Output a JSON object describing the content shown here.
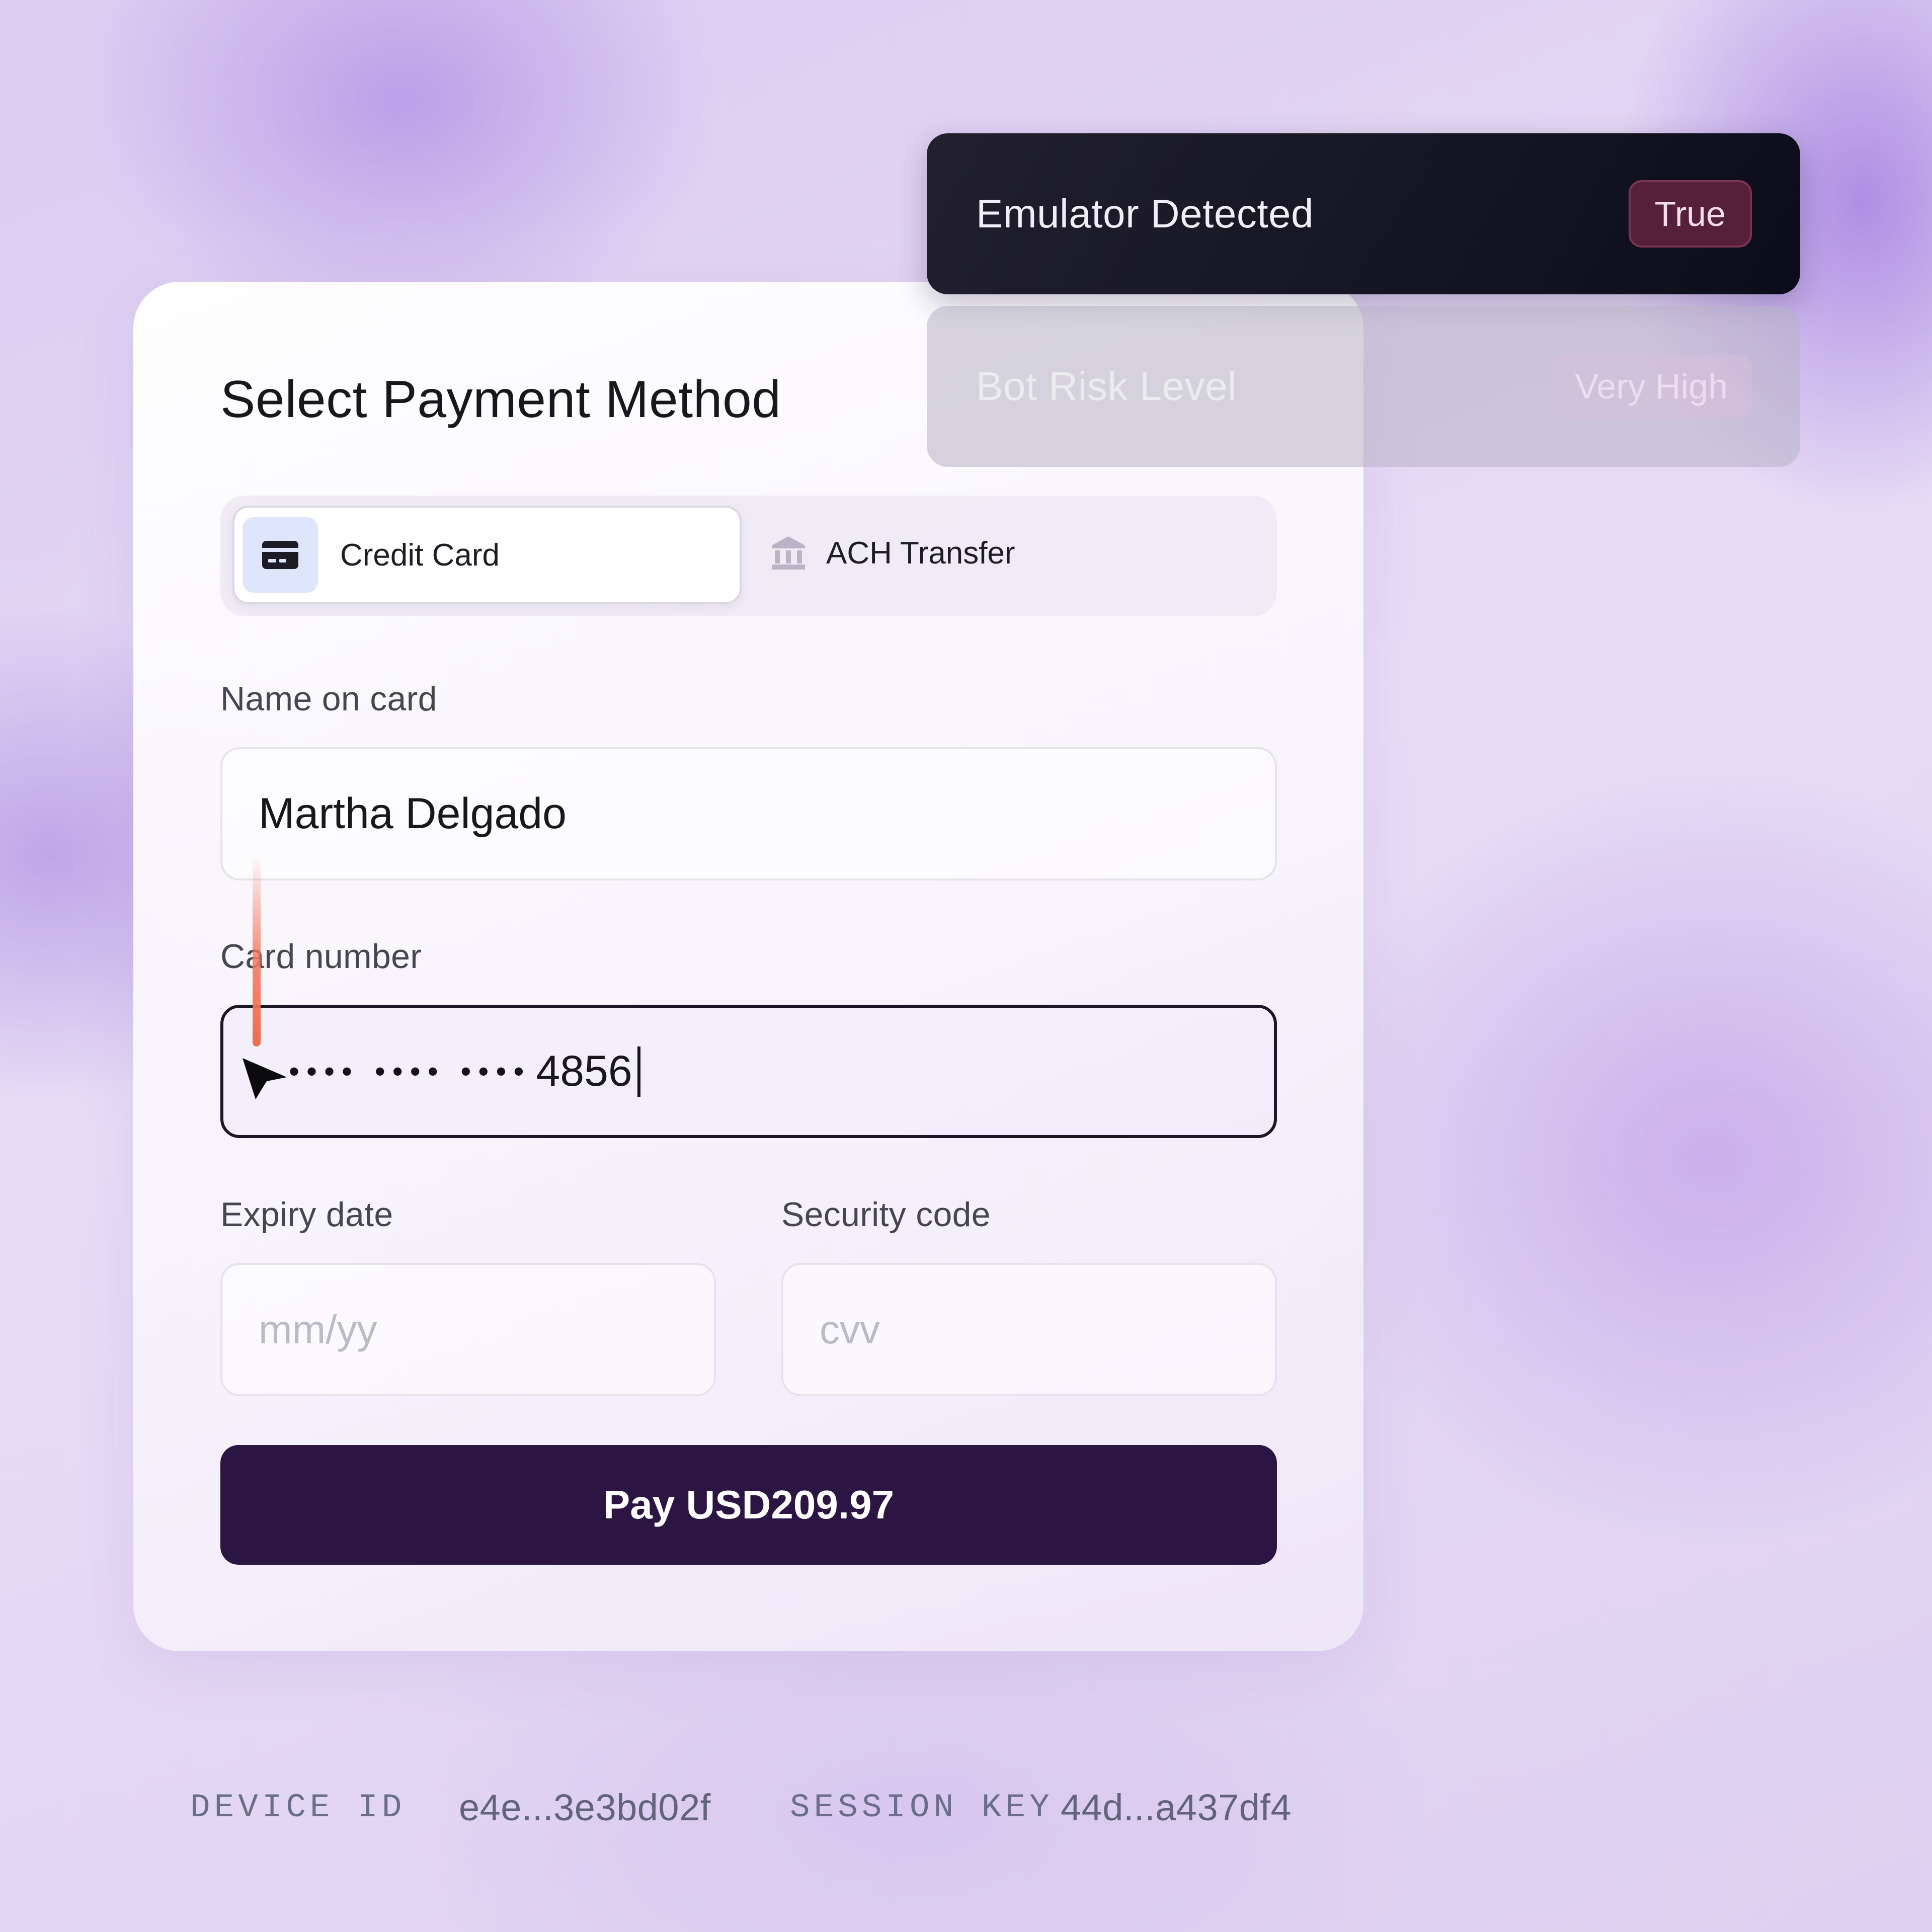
{
  "form": {
    "title": "Select Payment Method",
    "tabs": [
      {
        "label": "Credit Card",
        "icon": "credit-card-icon",
        "selected": true
      },
      {
        "label": "ACH Transfer",
        "icon": "bank-icon",
        "selected": false
      }
    ],
    "name_label": "Name on card",
    "name_value": "Martha Delgado",
    "card_label": "Card number",
    "card_masked": "•••• •••• ••••",
    "card_last4": "4856",
    "expiry_label": "Expiry date",
    "expiry_placeholder": "mm/yy",
    "cvv_label": "Security code",
    "cvv_placeholder": "cvv",
    "pay_button": "Pay USD209.97"
  },
  "risk_panel": [
    {
      "label": "Emulator Detected",
      "badge": "True"
    },
    {
      "label": "Bot Risk Level",
      "badge": "Very High"
    }
  ],
  "footer": {
    "device_id_key": "DEVICE ID",
    "device_id_value": "e4e...3e3bd02f",
    "session_key_key": "SESSION KEY",
    "session_key_value": "44d...a437df4"
  },
  "colors": {
    "accent_button": "#2c1542",
    "emulator_badge": "#56203a",
    "drag_trail": "#ee6d4f"
  }
}
